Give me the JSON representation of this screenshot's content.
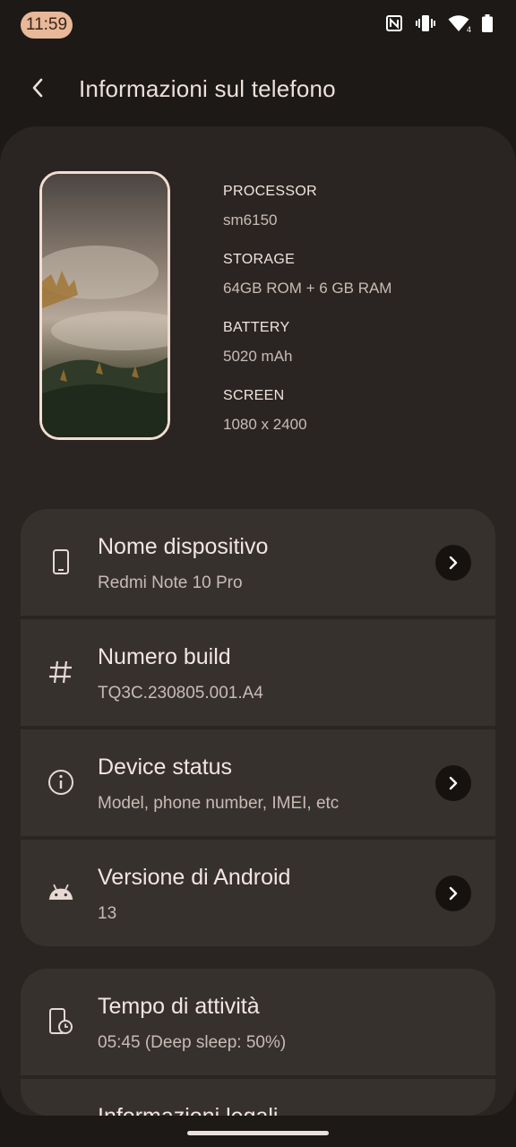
{
  "status_bar": {
    "time": "11:59",
    "icons": [
      "nfc-icon",
      "vibrate-icon",
      "wifi-icon",
      "battery-icon"
    ],
    "wifi_badge": "4"
  },
  "header": {
    "title": "Informazioni sul telefono",
    "back_icon": "back-arrow-icon"
  },
  "specs": [
    {
      "label": "PROCESSOR",
      "value": "sm6150"
    },
    {
      "label": "STORAGE",
      "value": "64GB ROM + 6 GB RAM"
    },
    {
      "label": "BATTERY",
      "value": "5020 mAh"
    },
    {
      "label": "SCREEN",
      "value": "1080 x 2400"
    }
  ],
  "group1": [
    {
      "title": "Nome dispositivo",
      "subtitle": "Redmi Note 10 Pro",
      "icon": "phone-icon",
      "chevron": true
    },
    {
      "title": "Numero build",
      "subtitle": "TQ3C.230805.001.A4",
      "icon": "hash-icon",
      "chevron": false
    },
    {
      "title": "Device status",
      "subtitle": "Model, phone number, IMEI, etc",
      "icon": "info-icon",
      "chevron": true
    },
    {
      "title": "Versione di Android",
      "subtitle": "13",
      "icon": "android-icon",
      "chevron": true
    }
  ],
  "group2": [
    {
      "title": "Tempo di attività",
      "subtitle": "05:45 (Deep sleep: 50%)",
      "icon": "phone-clock-icon",
      "chevron": false
    },
    {
      "title": "Informazioni legali",
      "subtitle": "",
      "icon": "",
      "chevron": true
    }
  ],
  "colors": {
    "background": "#1d1917",
    "panel": "#2a2522",
    "card": "#37312e",
    "clock_pill": "#e8b899",
    "text_primary": "#f2e6e0",
    "text_secondary": "#c8bbb4"
  }
}
